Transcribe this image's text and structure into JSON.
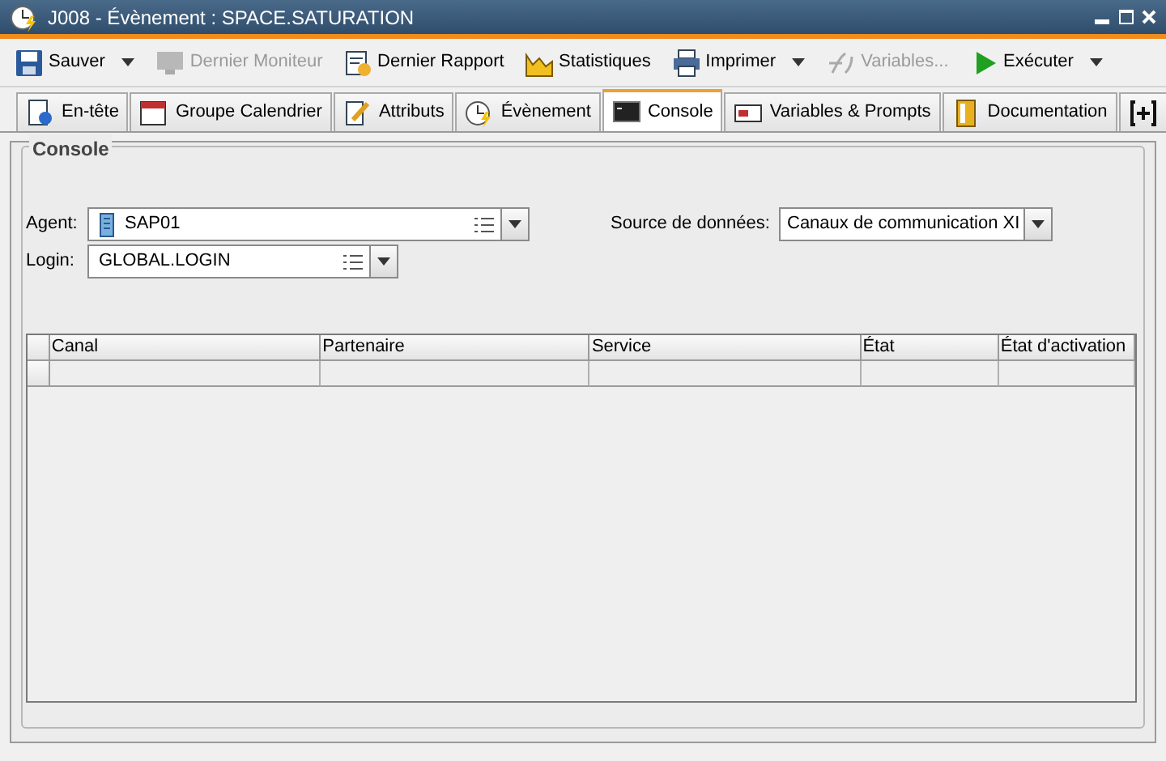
{
  "window": {
    "title": "J008 - Évènement : SPACE.SATURATION"
  },
  "toolbar": [
    {
      "label": "Sauver",
      "disabled": false,
      "dropdown": true
    },
    {
      "label": "Dernier Moniteur",
      "disabled": true,
      "dropdown": false
    },
    {
      "label": "Dernier Rapport",
      "disabled": false,
      "dropdown": false
    },
    {
      "label": "Statistiques",
      "disabled": false,
      "dropdown": false
    },
    {
      "label": "Imprimer",
      "disabled": false,
      "dropdown": true
    },
    {
      "label": "Variables...",
      "disabled": true,
      "dropdown": false
    },
    {
      "label": "Exécuter",
      "disabled": false,
      "dropdown": true
    }
  ],
  "tabs": [
    {
      "label": "En-tête",
      "selected": false
    },
    {
      "label": "Groupe Calendrier",
      "selected": false
    },
    {
      "label": "Attributs",
      "selected": false
    },
    {
      "label": "Évènement",
      "selected": false
    },
    {
      "label": "Console",
      "selected": true
    },
    {
      "label": "Variables & Prompts",
      "selected": false
    },
    {
      "label": "Documentation",
      "selected": false
    },
    {
      "selected": false
    }
  ],
  "console": {
    "title": "Console",
    "agent": {
      "label": "Agent:",
      "value": "SAP01"
    },
    "login": {
      "label": "Login:",
      "value": "GLOBAL.LOGIN"
    },
    "source": {
      "label": "Source de données:",
      "value": "Canaux de communication XI"
    }
  },
  "table": {
    "columns": [
      "Canal",
      "Partenaire",
      "Service",
      "État",
      "État d'activation"
    ]
  }
}
